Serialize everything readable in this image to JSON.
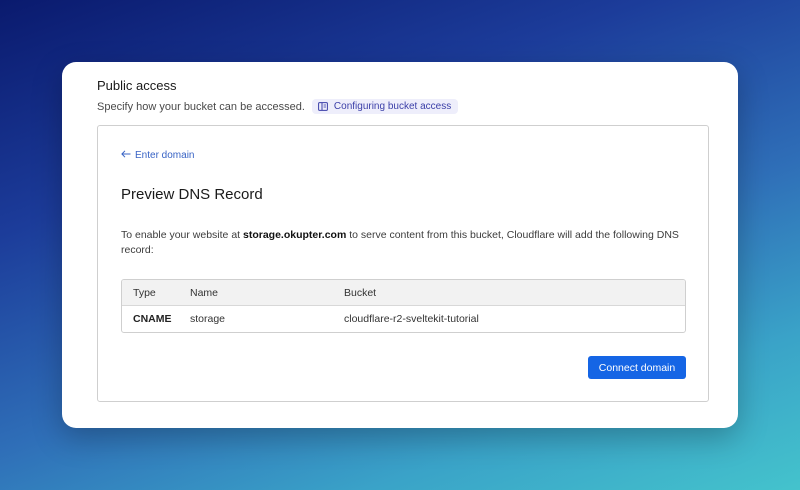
{
  "section": {
    "title": "Public access",
    "description": "Specify how your bucket can be accessed.",
    "doc_link_label": "Configuring bucket access"
  },
  "panel": {
    "back_link_label": "Enter domain",
    "title": "Preview DNS Record",
    "text_before": "To enable your website at ",
    "domain": "storage.okupter.com",
    "text_after": " to serve content from this bucket, Cloudflare will add the following DNS record:",
    "table": {
      "columns": [
        "Type",
        "Name",
        "Bucket"
      ],
      "rows": [
        {
          "type": "CNAME",
          "name": "storage",
          "bucket": "cloudflare-r2-sveltekit-tutorial"
        }
      ]
    },
    "connect_button_label": "Connect domain"
  },
  "colors": {
    "primary_button": "#1565e5",
    "link": "#3863c5",
    "doc_badge_bg": "#eeeefb"
  },
  "icons": {
    "doc_link": "book-icon",
    "back_link": "arrow-left-icon"
  }
}
